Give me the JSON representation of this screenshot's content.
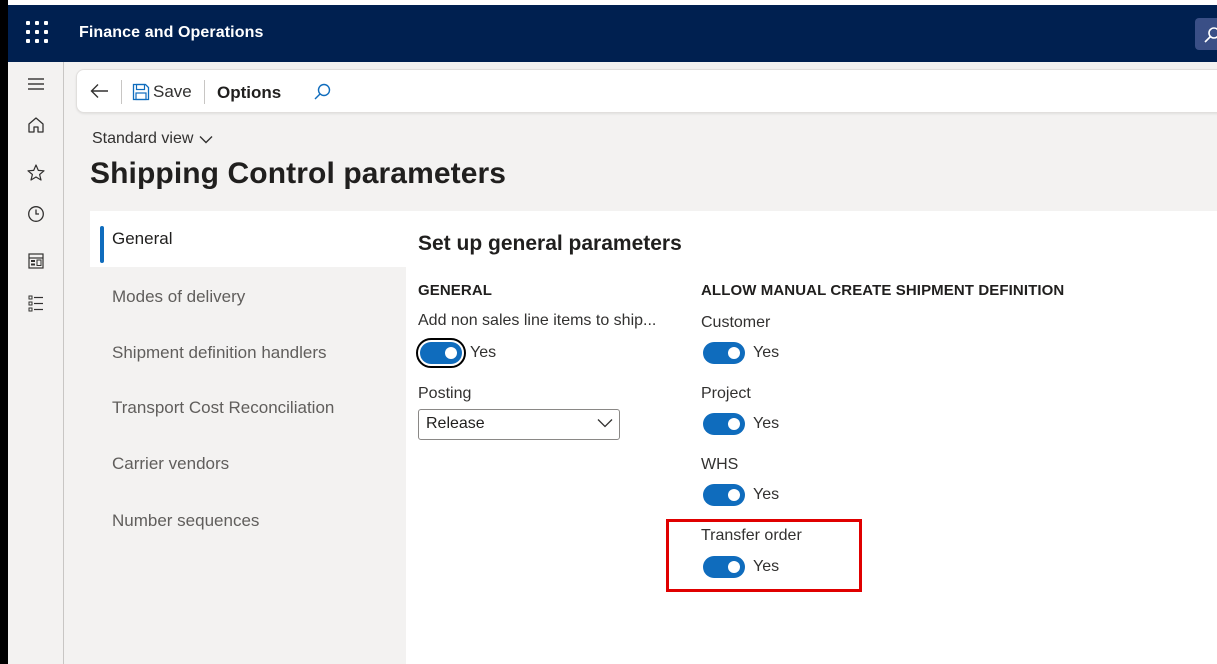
{
  "app": {
    "title": "Finance and Operations"
  },
  "nav": {
    "icons": [
      "menu-icon",
      "home-icon",
      "star-icon",
      "clock-icon",
      "workspace-icon",
      "modules-icon"
    ]
  },
  "action_pane": {
    "save_label": "Save",
    "options_label": "Options"
  },
  "header": {
    "view_selector": "Standard view",
    "page_title": "Shipping Control parameters"
  },
  "tabs": [
    {
      "label": "General",
      "active": true
    },
    {
      "label": "Modes of delivery",
      "active": false
    },
    {
      "label": "Shipment definition handlers",
      "active": false
    },
    {
      "label": "Transport Cost Reconciliation",
      "active": false
    },
    {
      "label": "Carrier vendors",
      "active": false
    },
    {
      "label": "Number sequences",
      "active": false
    }
  ],
  "content": {
    "section_title": "Set up general parameters",
    "general": {
      "heading": "GENERAL",
      "add_non_sales": {
        "label": "Add non sales line items to ship...",
        "value": "Yes"
      },
      "posting": {
        "label": "Posting",
        "value": "Release"
      }
    },
    "manual_create": {
      "heading": "ALLOW MANUAL CREATE SHIPMENT DEFINITION",
      "customer": {
        "label": "Customer",
        "value": "Yes"
      },
      "project": {
        "label": "Project",
        "value": "Yes"
      },
      "whs": {
        "label": "WHS",
        "value": "Yes"
      },
      "transfer_order": {
        "label": "Transfer order",
        "value": "Yes"
      }
    }
  },
  "colors": {
    "topbar": "#002050",
    "accent": "#0f6cbd",
    "highlight": "#e00000"
  }
}
